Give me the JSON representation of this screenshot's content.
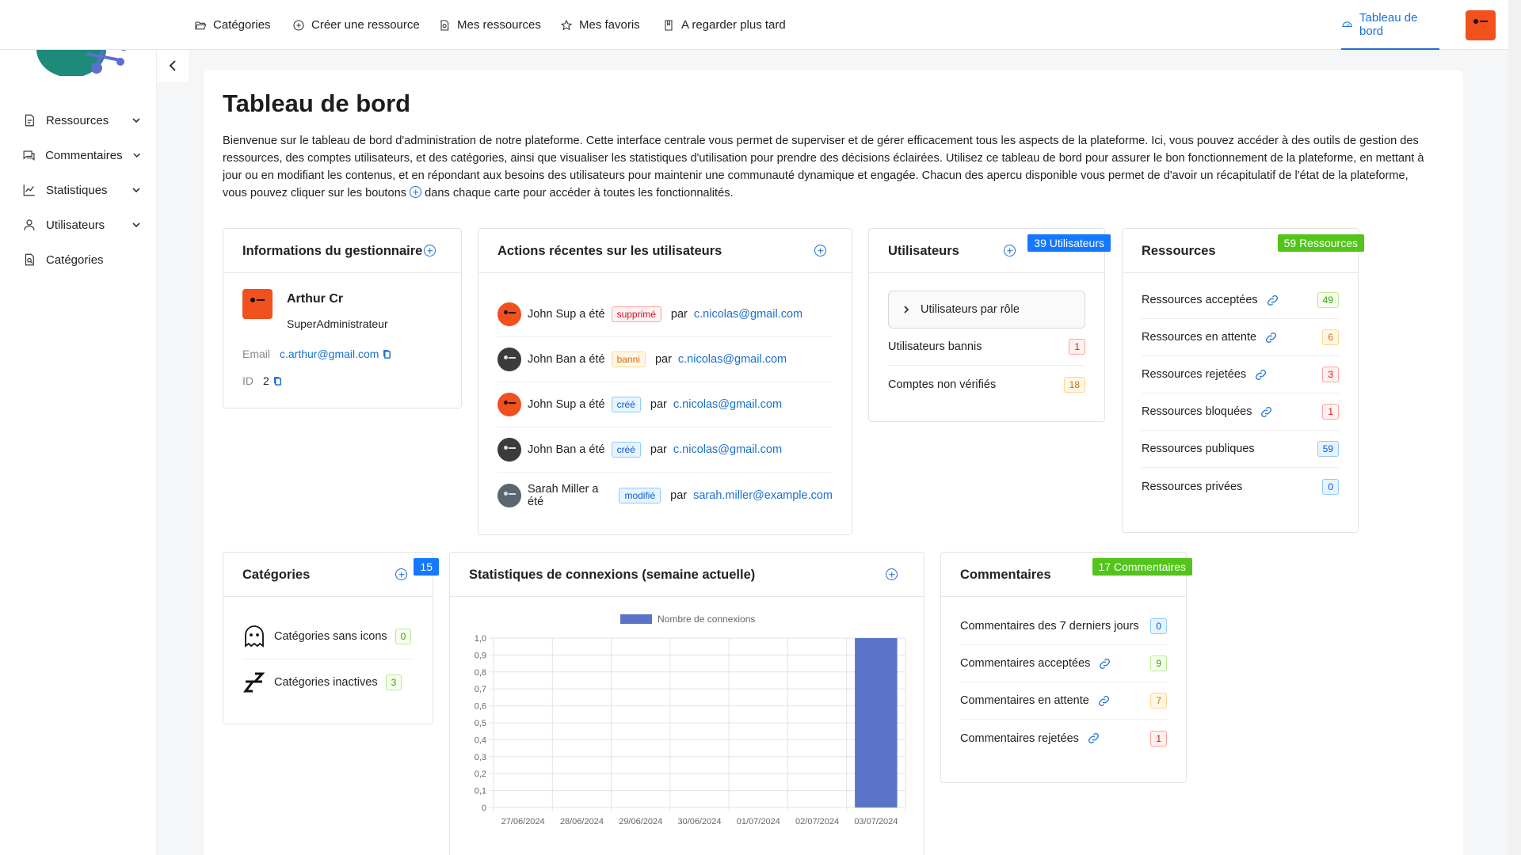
{
  "nav": {
    "items": [
      "Catégories",
      "Créer une ressource",
      "Mes ressources",
      "Mes favoris",
      "A regarder plus tard"
    ],
    "dashboard": "Tableau de bord"
  },
  "sidebar": {
    "items": [
      "Ressources",
      "Commentaires",
      "Statistiques",
      "Utilisateurs",
      "Catégories"
    ]
  },
  "page": {
    "title": "Tableau de bord",
    "intro": "Bienvenue sur le tableau de bord d'administration de notre plateforme. Cette interface centrale vous permet de superviser et de gérer efficacement tous les aspects de la plateforme. Ici, vous pouvez accéder à des outils de gestion des ressources, des comptes utilisateurs, et des catégories, ainsi que visualiser les statistiques d'utilisation pour prendre des décisions éclairées. Utilisez ce tableau de bord pour assurer le bon fonctionnement de la plateforme, en mettant à jour ou en modifiant les contenus, et en répondant aux besoins des utilisateurs pour maintenir une communauté dynamique et engagée. Chacun des apercu disponible vous permet de d'avoir un récapitulatif de l'état de la plateforme, vous pouvez cliquer sur les boutons",
    "intro_end": "dans chaque carte pour accéder à toutes les fonctionnalités."
  },
  "manager": {
    "title": "Informations du gestionnaire",
    "name": "Arthur Cr",
    "role": "SuperAdministrateur",
    "email_label": "Email",
    "email": "c.arthur@gmail.com",
    "id_label": "ID",
    "id": "2"
  },
  "actions": {
    "title": "Actions récentes sur les utilisateurs",
    "items": [
      {
        "text": "John Sup a été",
        "tag": "supprimé",
        "by": "par",
        "email": "c.nicolas@gmail.com"
      },
      {
        "text": "John Ban a été",
        "tag": "banni",
        "by": "par",
        "email": "c.nicolas@gmail.com"
      },
      {
        "text": "John Sup a été",
        "tag": "créé",
        "by": "par",
        "email": "c.nicolas@gmail.com"
      },
      {
        "text": "John Ban a été",
        "tag": "créé",
        "by": "par",
        "email": "c.nicolas@gmail.com"
      },
      {
        "text": "Sarah Miller a été",
        "tag": "modifié",
        "by": "par",
        "email": "sarah.miller@example.com"
      }
    ]
  },
  "users": {
    "title": "Utilisateurs",
    "badge": "39 Utilisateurs",
    "by_role": "Utilisateurs par rôle",
    "rows": [
      {
        "label": "Utilisateurs bannis",
        "count": "1"
      },
      {
        "label": "Comptes non vérifiés",
        "count": "18"
      }
    ]
  },
  "resources": {
    "title": "Ressources",
    "badge": "59 Ressources",
    "rows": [
      {
        "label": "Ressources acceptées",
        "count": "49"
      },
      {
        "label": "Ressources en attente",
        "count": "6"
      },
      {
        "label": "Ressources rejetées",
        "count": "3"
      },
      {
        "label": "Ressources bloquées",
        "count": "1"
      },
      {
        "label": "Ressources publiques",
        "count": "59"
      },
      {
        "label": "Ressources privées",
        "count": "0"
      }
    ]
  },
  "categories": {
    "title": "Catégories",
    "badge": "15",
    "rows": [
      {
        "label": "Catégories sans icons",
        "count": "0"
      },
      {
        "label": "Catégories inactives",
        "count": "3"
      }
    ]
  },
  "stats": {
    "title": "Statistiques de connexions (semaine actuelle)"
  },
  "comments": {
    "title": "Commentaires",
    "badge": "17 Commentaires",
    "rows": [
      {
        "label": "Commentaires des 7 derniers jours",
        "count": "0"
      },
      {
        "label": "Commentaires acceptées",
        "count": "9"
      },
      {
        "label": "Commentaires en attente",
        "count": "7"
      },
      {
        "label": "Commentaires rejetées",
        "count": "1"
      }
    ]
  },
  "colors": {
    "accent": "#1a6fd1",
    "bar": "#5b73c6",
    "ribbon_blue": "#1677ff",
    "ribbon_green": "#52c41a",
    "avatar": "#f2501d"
  },
  "chart_data": {
    "type": "bar",
    "categories": [
      "27/06/2024",
      "28/06/2024",
      "29/06/2024",
      "30/06/2024",
      "01/07/2024",
      "02/07/2024",
      "03/07/2024"
    ],
    "series": [
      {
        "name": "Nombre de connexions",
        "values": [
          0,
          0,
          0,
          0,
          0,
          0,
          1
        ]
      }
    ],
    "ylim": [
      0,
      1
    ],
    "yticks": [
      "0",
      "0,1",
      "0,2",
      "0,3",
      "0,4",
      "0,5",
      "0,6",
      "0,7",
      "0,8",
      "0,9",
      "1,0"
    ],
    "legend": "top",
    "grid": true
  }
}
